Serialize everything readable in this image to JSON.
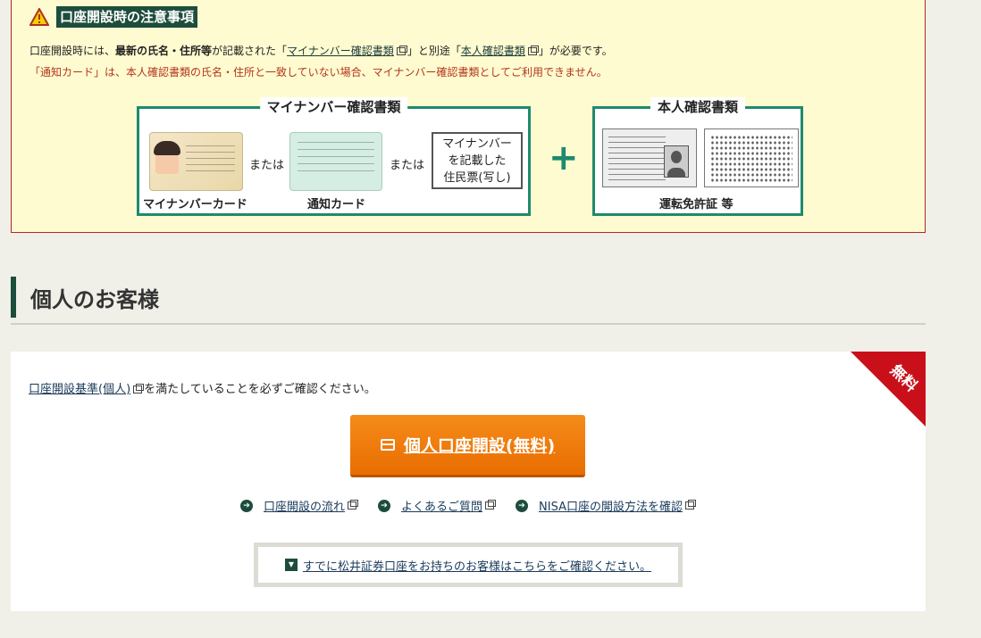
{
  "notice": {
    "title": "口座開設時の注意事項",
    "line1_prefix": "口座開設時には、",
    "line1_bold": "最新の氏名・住所等",
    "line1_mid": "が記載された「",
    "line1_link1": "マイナンバー確認書類",
    "line1_mid2": "」と別途「",
    "line1_link2": "本人確認書類",
    "line1_suffix": "」が必要です。",
    "line2": "「通知カード」は、本人確認書類の氏名・住所と一致していない場合、マイナンバー確認書類としてご利用できません。"
  },
  "mynumber_docs": {
    "label": "マイナンバー確認書類",
    "or1": "または",
    "or2": "または",
    "card_caption": "マイナンバーカード",
    "notify_caption": "通知カード",
    "juminhyo_line1": "マイナンバー",
    "juminhyo_line2": "を記載した",
    "juminhyo_line3": "住民票(写し)"
  },
  "plus_sign": "+",
  "id_docs": {
    "label": "本人確認書類",
    "caption": "運転免許証 等"
  },
  "section": {
    "title": "個人のお客様"
  },
  "panel": {
    "ribbon": "無料",
    "intro_link": "口座開設基準(個人)",
    "intro_text": "を満たしていることを必ずご確認ください。",
    "cta_label": "個人口座開設(無料)",
    "links": [
      {
        "label": "口座開設の流れ"
      },
      {
        "label": "よくあるご質問"
      },
      {
        "label": "NISA口座の開設方法を確認"
      }
    ],
    "existing_label": "すでに松井証券口座をお持ちのお客様はこちらをご確認ください。"
  }
}
